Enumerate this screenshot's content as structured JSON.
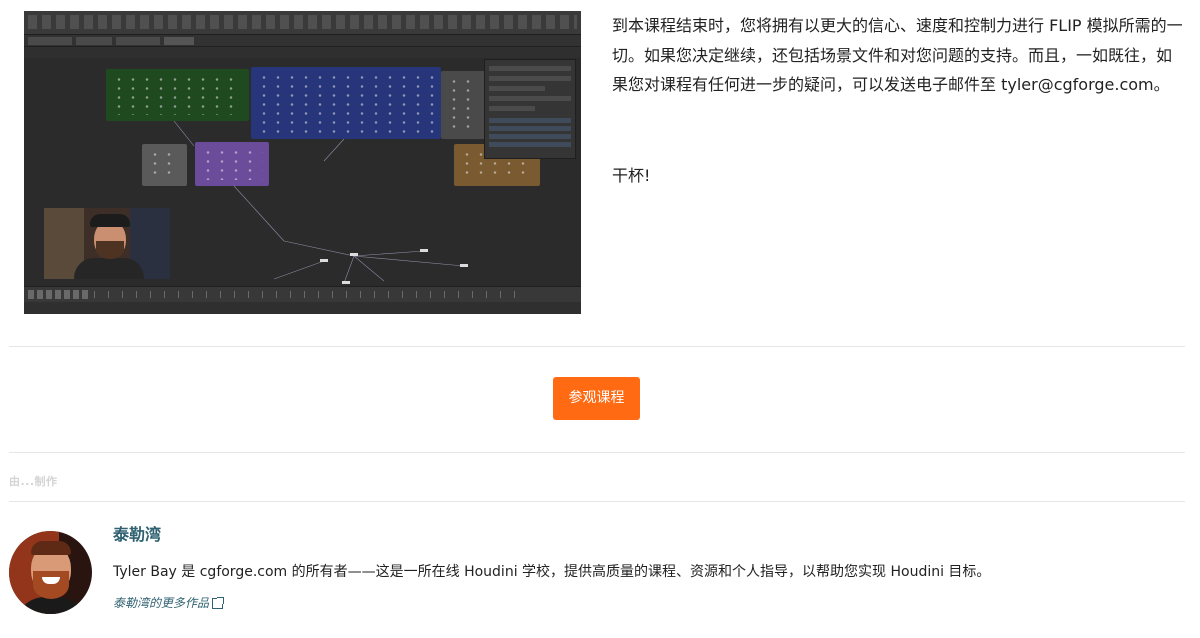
{
  "intro": {
    "paragraph": "到本课程结束时，您将拥有以更大的信心、速度和控制力进行 FLIP 模拟所需的一切。如果您决定继续，还包括场景文件和对您问题的支持。而且，一如既往，如果您对课程有任何进一步的疑问，可以发送电子邮件至 tyler@cgforge.com。",
    "closing": "干杯!"
  },
  "screenshot": {
    "icons": {
      "screenshot": "houdini-node-network-screenshot",
      "webcam": "instructor-webcam-thumbnail"
    },
    "colors": {
      "green_net": "#1f4a1f",
      "blue_net": "#27357a",
      "gray_net": "#5a5a5a",
      "purple_net": "#6a4c9a",
      "orange_net": "#7a5a30"
    }
  },
  "cta": {
    "label": "参观课程",
    "color": "#ff6a13"
  },
  "author_section": {
    "made_by_label": "由...制作",
    "name": "泰勒湾",
    "bio": "Tyler Bay 是 cgforge.com 的所有者——这是一所在线 Houdini 学校，提供高质量的课程、资源和个人指导，以帮助您实现 Houdini 目标。",
    "more_link": "泰勒湾的更多作品",
    "link_color": "#2f6171",
    "icons": {
      "avatar": "author-avatar",
      "more_link": "external-link-icon"
    }
  }
}
